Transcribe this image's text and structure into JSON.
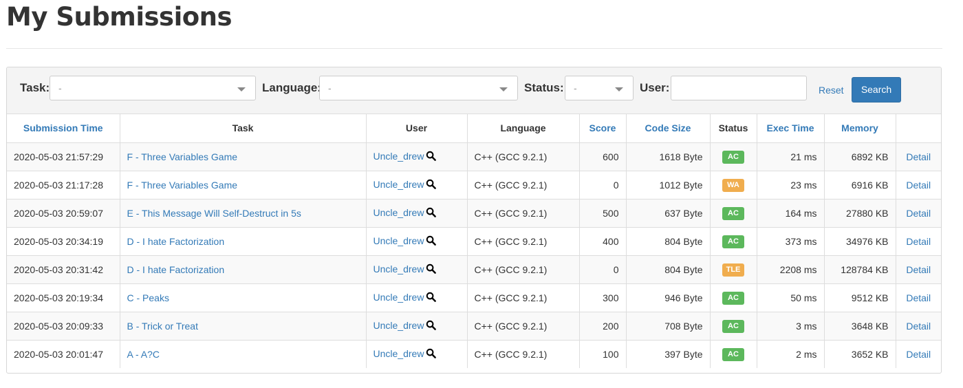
{
  "page": {
    "title": "My Submissions"
  },
  "filters": {
    "task_label": "Task:",
    "task_value": "-",
    "language_label": "Language:",
    "language_value": "-",
    "status_label": "Status:",
    "status_value": "-",
    "user_label": "User:",
    "user_value": "",
    "reset_label": "Reset",
    "search_label": "Search"
  },
  "table": {
    "headers": {
      "time": "Submission Time",
      "task": "Task",
      "user": "User",
      "language": "Language",
      "score": "Score",
      "code_size": "Code Size",
      "status": "Status",
      "exec_time": "Exec Time",
      "memory": "Memory"
    },
    "detail_label": "Detail",
    "status_colors": {
      "AC": "#5cb85c",
      "WA": "#f0ad4e",
      "TLE": "#f0ad4e"
    },
    "rows": [
      {
        "time": "2020-05-03 21:57:29",
        "task": "F - Three Variables Game",
        "user": "Uncle_drew",
        "language": "C++ (GCC 9.2.1)",
        "score": "600",
        "code_size": "1618 Byte",
        "status": "AC",
        "exec_time": "21 ms",
        "memory": "6892 KB"
      },
      {
        "time": "2020-05-03 21:17:28",
        "task": "F - Three Variables Game",
        "user": "Uncle_drew",
        "language": "C++ (GCC 9.2.1)",
        "score": "0",
        "code_size": "1012 Byte",
        "status": "WA",
        "exec_time": "23 ms",
        "memory": "6916 KB"
      },
      {
        "time": "2020-05-03 20:59:07",
        "task": "E - This Message Will Self-Destruct in 5s",
        "user": "Uncle_drew",
        "language": "C++ (GCC 9.2.1)",
        "score": "500",
        "code_size": "637 Byte",
        "status": "AC",
        "exec_time": "164 ms",
        "memory": "27880 KB"
      },
      {
        "time": "2020-05-03 20:34:19",
        "task": "D - I hate Factorization",
        "user": "Uncle_drew",
        "language": "C++ (GCC 9.2.1)",
        "score": "400",
        "code_size": "804 Byte",
        "status": "AC",
        "exec_time": "373 ms",
        "memory": "34976 KB"
      },
      {
        "time": "2020-05-03 20:31:42",
        "task": "D - I hate Factorization",
        "user": "Uncle_drew",
        "language": "C++ (GCC 9.2.1)",
        "score": "0",
        "code_size": "804 Byte",
        "status": "TLE",
        "exec_time": "2208 ms",
        "memory": "128784 KB"
      },
      {
        "time": "2020-05-03 20:19:34",
        "task": "C - Peaks",
        "user": "Uncle_drew",
        "language": "C++ (GCC 9.2.1)",
        "score": "300",
        "code_size": "946 Byte",
        "status": "AC",
        "exec_time": "50 ms",
        "memory": "9512 KB"
      },
      {
        "time": "2020-05-03 20:09:33",
        "task": "B - Trick or Treat",
        "user": "Uncle_drew",
        "language": "C++ (GCC 9.2.1)",
        "score": "200",
        "code_size": "708 Byte",
        "status": "AC",
        "exec_time": "3 ms",
        "memory": "3648 KB"
      },
      {
        "time": "2020-05-03 20:01:47",
        "task": "A - A?C",
        "user": "Uncle_drew",
        "language": "C++ (GCC 9.2.1)",
        "score": "100",
        "code_size": "397 Byte",
        "status": "AC",
        "exec_time": "2 ms",
        "memory": "3652 KB"
      }
    ]
  }
}
